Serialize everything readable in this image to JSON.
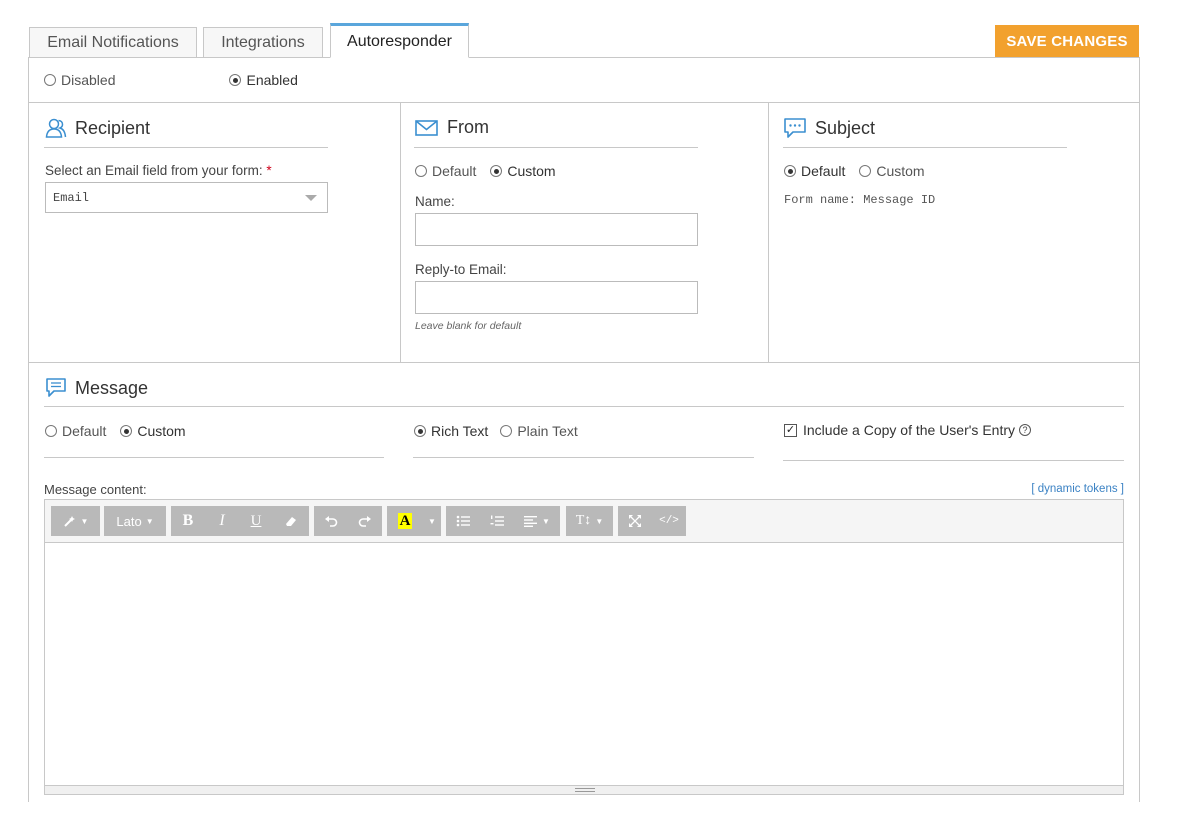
{
  "tabs": [
    {
      "label": "Email Notifications"
    },
    {
      "label": "Integrations"
    },
    {
      "label": "Autoresponder"
    }
  ],
  "save_button": "SAVE CHANGES",
  "status": {
    "disabled": "Disabled",
    "enabled": "Enabled",
    "selected": "Enabled"
  },
  "recipient": {
    "title": "Recipient",
    "select_label": "Select an Email field from your form:",
    "required_mark": "*",
    "select_value": "Email"
  },
  "from": {
    "title": "From",
    "default": "Default",
    "custom": "Custom",
    "selected": "Custom",
    "name_label": "Name:",
    "name_value": "",
    "reply_label": "Reply-to Email:",
    "reply_value": "",
    "reply_hint": "Leave blank for default"
  },
  "subject": {
    "title": "Subject",
    "default": "Default",
    "custom": "Custom",
    "selected": "Default",
    "preview": "Form name: Message ID"
  },
  "message": {
    "title": "Message",
    "default": "Default",
    "custom": "Custom",
    "selected": "Custom",
    "rich_text": "Rich Text",
    "plain_text": "Plain Text",
    "format_selected": "Rich Text",
    "include_copy": "Include a Copy of the User's Entry",
    "include_copy_checked": true,
    "help_glyph": "?",
    "content_label": "Message content:",
    "tokens_link": "[ dynamic tokens ]"
  },
  "toolbar": {
    "font": "Lato",
    "bold": "B",
    "italic": "I",
    "underline": "U",
    "highlight": "A",
    "text_size": "T↕",
    "code": "</>"
  },
  "colors": {
    "accent": "#f2a12e",
    "tab_active": "#5aa6dc",
    "icon_blue": "#3b8fd0",
    "link": "#3b82c4"
  }
}
